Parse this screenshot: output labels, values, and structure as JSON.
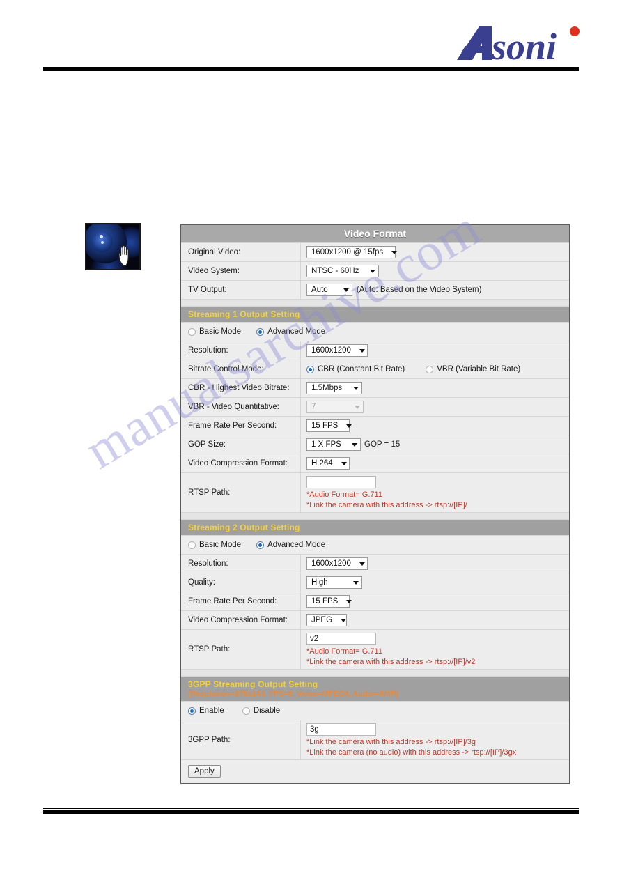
{
  "brand": {
    "name": "Asoni",
    "logo_dot_color": "#e03020",
    "logo_color": "#3b3f8f"
  },
  "watermark": {
    "text": "manualsarchive.com",
    "color": "#8f8fd6"
  },
  "thumbnail": {
    "alt": "camera-lens-thumbnail",
    "cursor": "hand-pointer"
  },
  "panel": {
    "title": "Video Format",
    "top_rows": [
      {
        "label": "Original Video:",
        "value": "1600x1200 @ 15fps",
        "control": "select",
        "width_class": "w-ov"
      },
      {
        "label": "Video System:",
        "value": "NTSC - 60Hz",
        "control": "select",
        "width_class": "w-vs"
      },
      {
        "label": "TV Output:",
        "value": "Auto",
        "control": "select",
        "width_class": "w-tv",
        "note": "(Auto: Based on the Video System)"
      }
    ],
    "streaming1": {
      "header": "Streaming 1 Output Setting",
      "mode": {
        "basic_label": "Basic Mode",
        "advanced_label": "Advanced Mode",
        "selected": "Advanced Mode"
      },
      "resolution": {
        "label": "Resolution:",
        "value": "1600x1200"
      },
      "bitrate_control": {
        "label": "Bitrate Control Mode:",
        "cbr_label": "CBR (Constant Bit Rate)",
        "vbr_label": "VBR (Variable Bit Rate)",
        "selected": "CBR (Constant Bit Rate)"
      },
      "cbr_bitrate": {
        "label": "CBR - Highest Video Bitrate:",
        "value": "1.5Mbps"
      },
      "vbr_quant": {
        "label": "VBR - Video Quantitative:",
        "value": "7",
        "disabled": true
      },
      "fps": {
        "label": "Frame Rate Per Second:",
        "value": "15 FPS"
      },
      "gop": {
        "label": "GOP Size:",
        "value": "1 X FPS",
        "note": "GOP = 15"
      },
      "compression": {
        "label": "Video Compression Format:",
        "value": "H.264"
      },
      "rtsp": {
        "label": "RTSP Path:",
        "value": "",
        "note1": "*Audio Format= G.711",
        "note2": "*Link the camera with this address -> rtsp://[IP]/"
      }
    },
    "streaming2": {
      "header": "Streaming 2 Output Setting",
      "mode": {
        "basic_label": "Basic Mode",
        "advanced_label": "Advanced Mode",
        "selected": "Advanced Mode"
      },
      "resolution": {
        "label": "Resolution:",
        "value": "1600x1200"
      },
      "quality": {
        "label": "Quality:",
        "value": "High"
      },
      "fps": {
        "label": "Frame Rate Per Second:",
        "value": "15 FPS"
      },
      "compression": {
        "label": "Video Compression Format:",
        "value": "JPEG"
      },
      "rtsp": {
        "label": "RTSP Path:",
        "value": "v2",
        "note1": "*Audio Format= G.711",
        "note2": "*Link the camera with this address -> rtsp://[IP]/v2"
      }
    },
    "threegpp": {
      "header_line1": "3GPP Streaming Output Setting",
      "header_line2": "(Resolution=176x144, FPS=5, Video=MPEG4, Audio=AMR)",
      "enable_label": "Enable",
      "disable_label": "Disable",
      "selected": "Enable",
      "path": {
        "label": "3GPP Path:",
        "value": "3g",
        "note1": "*Link the camera with this address -> rtsp://[IP]/3g",
        "note2": "*Link the camera (no audio) with this address -> rtsp://[IP]/3gx"
      }
    },
    "apply_label": "Apply"
  }
}
